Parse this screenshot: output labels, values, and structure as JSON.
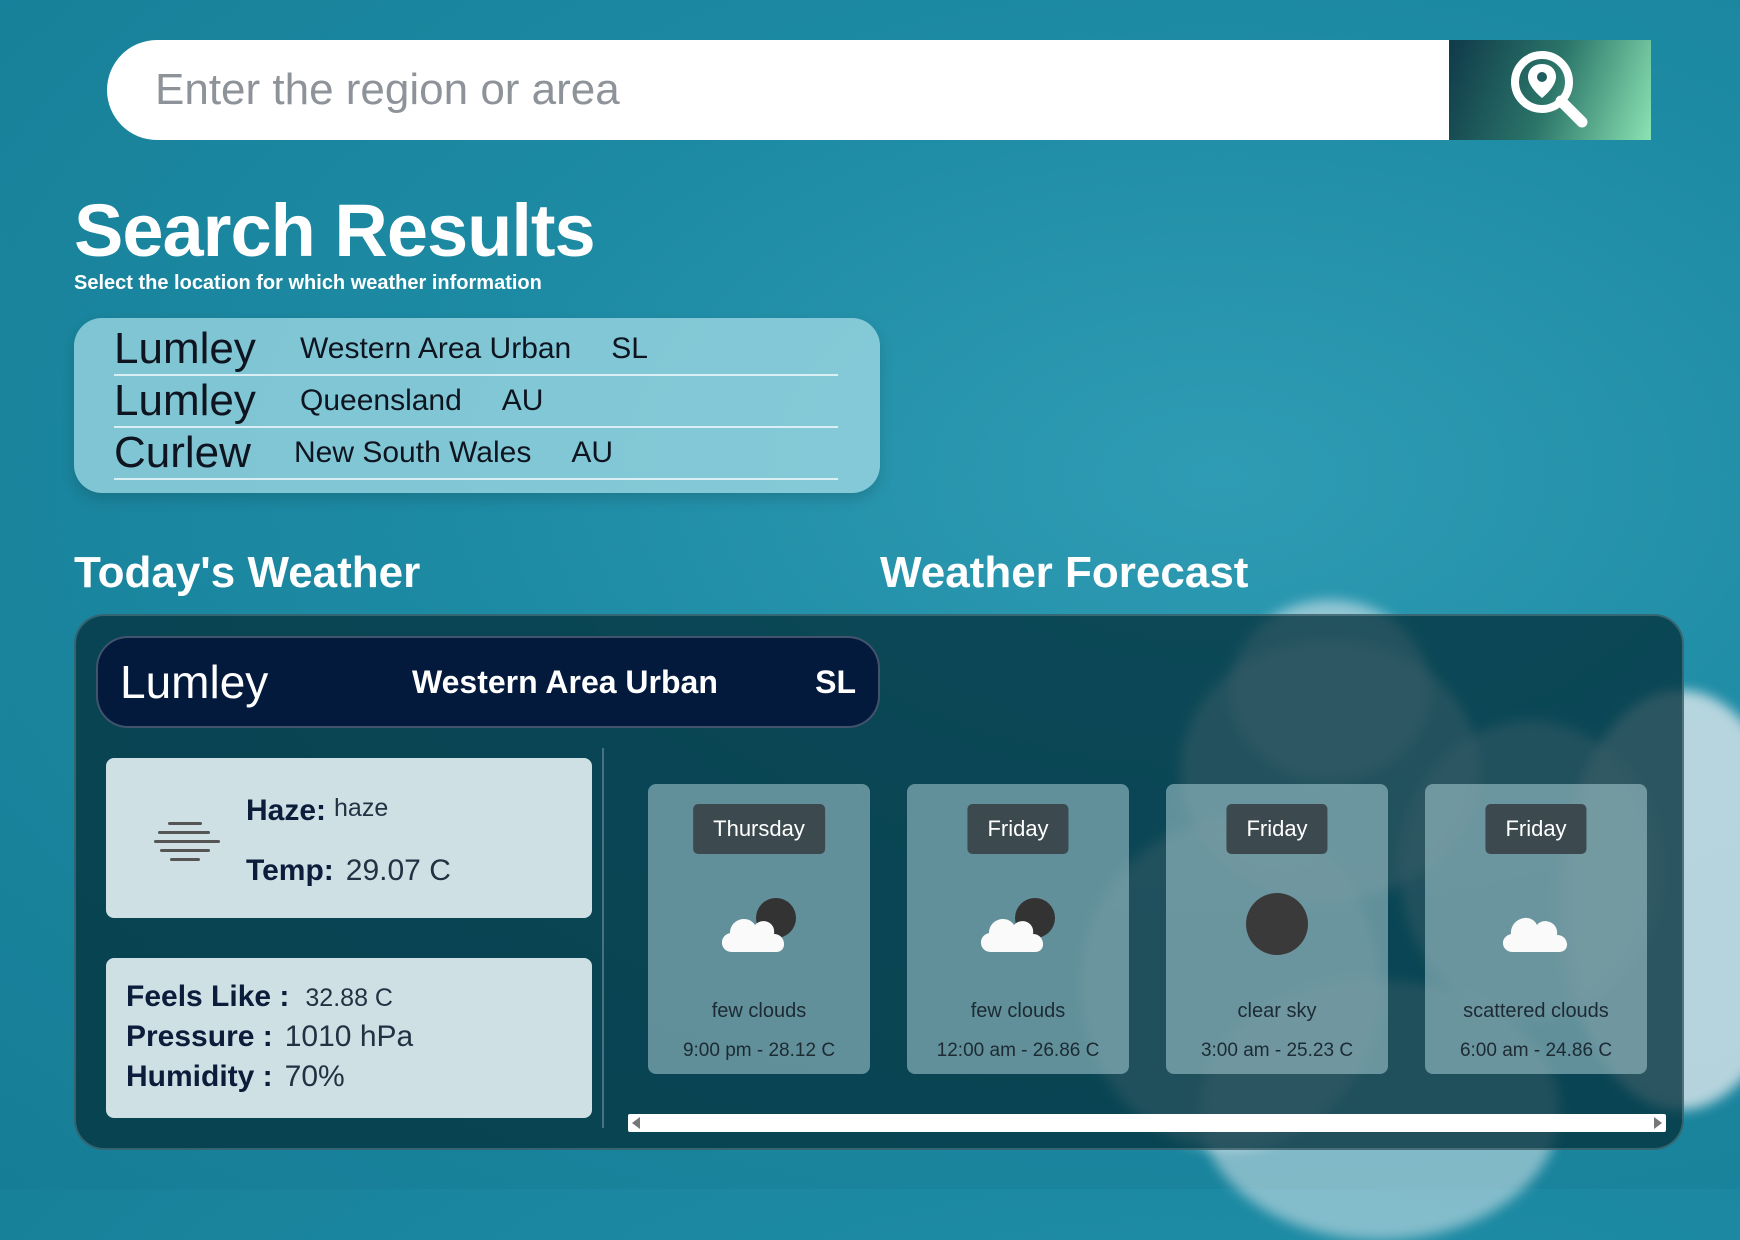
{
  "search": {
    "placeholder": "Enter the region or area",
    "button_icon": "location-search-icon"
  },
  "results": {
    "title": "Search Results",
    "subtitle": "Select the location for which weather information",
    "items": [
      {
        "city": "Lumley",
        "region": "Western Area Urban",
        "country": "SL"
      },
      {
        "city": "Lumley",
        "region": "Queensland",
        "country": "AU"
      },
      {
        "city": "Curlew",
        "region": "New South Wales",
        "country": "AU"
      }
    ]
  },
  "today": {
    "title": "Today's Weather",
    "city": "Lumley",
    "region": "Western Area Urban",
    "country": "SL",
    "condition_label": "Haze:",
    "condition_value": "haze",
    "condition_icon": "haze-icon",
    "temp_label": "Temp:",
    "temp_value": "29.07 C",
    "feels_label": "Feels Like :",
    "feels_value": "32.88 C",
    "pressure_label": "Pressure :",
    "pressure_value": "1010 hPa",
    "humidity_label": "Humidity :",
    "humidity_value": "70%"
  },
  "forecast": {
    "title": "Weather Forecast",
    "items": [
      {
        "day": "Thursday",
        "icon": "few-clouds-night-icon",
        "desc": "few clouds",
        "time": "9:00 pm - 28.12 C"
      },
      {
        "day": "Friday",
        "icon": "few-clouds-night-icon",
        "desc": "few clouds",
        "time": "12:00 am - 26.86 C"
      },
      {
        "day": "Friday",
        "icon": "clear-sky-night-icon",
        "desc": "clear sky",
        "time": "3:00 am - 25.23 C"
      },
      {
        "day": "Friday",
        "icon": "scattered-clouds-icon",
        "desc": "scattered clouds",
        "time": "6:00 am - 24.86 C"
      }
    ]
  }
}
